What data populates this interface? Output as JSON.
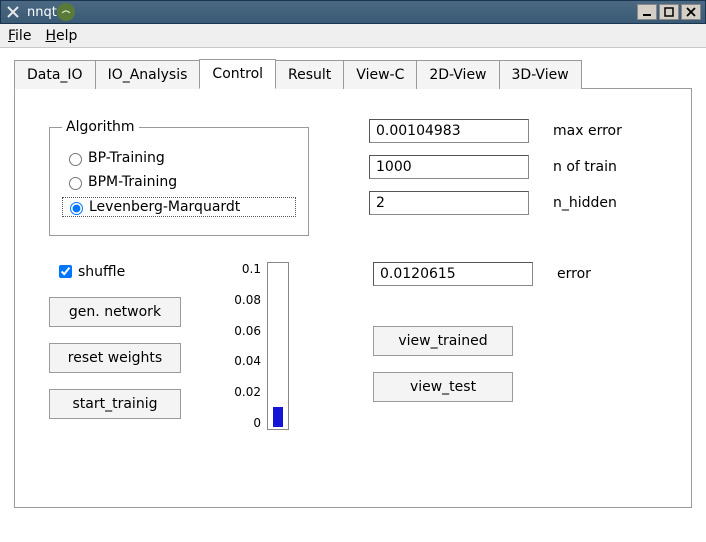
{
  "window": {
    "title": "nnqt"
  },
  "menubar": {
    "file": "File",
    "help": "Help"
  },
  "tabs": {
    "data_io": "Data_IO",
    "io_analysis": "IO_Analysis",
    "control": "Control",
    "result": "Result",
    "view_c": "View-C",
    "view_2d": "2D-View",
    "view_3d": "3D-View",
    "active": "control"
  },
  "algorithm": {
    "legend": "Algorithm",
    "options": {
      "bp": "BP-Training",
      "bpm": "BPM-Training",
      "lm": "Levenberg-Marquardt"
    },
    "selected": "lm"
  },
  "params": {
    "max_error": {
      "value": "0.00104983",
      "label": "max error"
    },
    "n_of_train": {
      "value": "1000",
      "label": "n of train"
    },
    "n_hidden": {
      "value": "2",
      "label": "n_hidden"
    },
    "error": {
      "value": "0.0120615",
      "label": "error"
    }
  },
  "controls": {
    "shuffle_label": "shuffle",
    "shuffle_checked": true,
    "gen_network": "gen. network",
    "reset_weights": "reset weights",
    "start_training": "start_trainig",
    "view_trained": "view_trained",
    "view_test": "view_test"
  },
  "chart_data": {
    "type": "bar",
    "ylim": [
      0,
      0.1
    ],
    "ticks": [
      "0.1",
      "0.08",
      "0.06",
      "0.04",
      "0.02",
      "0"
    ],
    "value": 0.0120615,
    "fill_percent": 12
  }
}
